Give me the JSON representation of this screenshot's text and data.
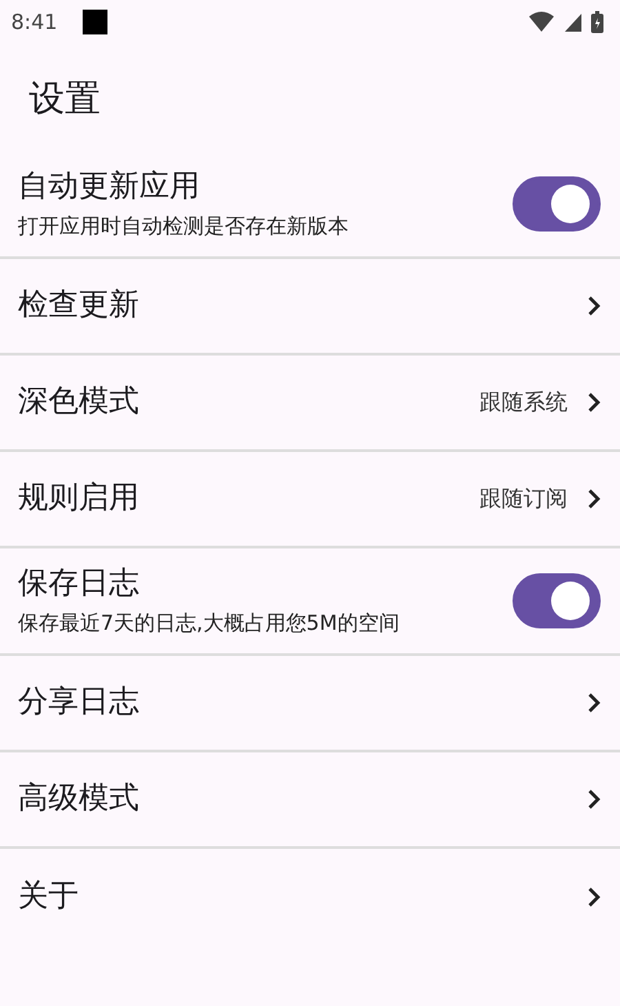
{
  "status_bar": {
    "time": "8:41"
  },
  "title": "设置",
  "items": [
    {
      "kind": "toggle",
      "label": "自动更新应用",
      "subtitle": "打开应用时自动检测是否存在新版本",
      "on": true
    },
    {
      "kind": "link",
      "label": "检查更新"
    },
    {
      "kind": "link",
      "label": "深色模式",
      "value": "跟随系统"
    },
    {
      "kind": "link",
      "label": "规则启用",
      "value": "跟随订阅"
    },
    {
      "kind": "toggle",
      "label": "保存日志",
      "subtitle": "保存最近7天的日志,大概占用您5M的空间",
      "on": true
    },
    {
      "kind": "link",
      "label": "分享日志"
    },
    {
      "kind": "link",
      "label": "高级模式"
    },
    {
      "kind": "link",
      "label": "关于"
    }
  ]
}
